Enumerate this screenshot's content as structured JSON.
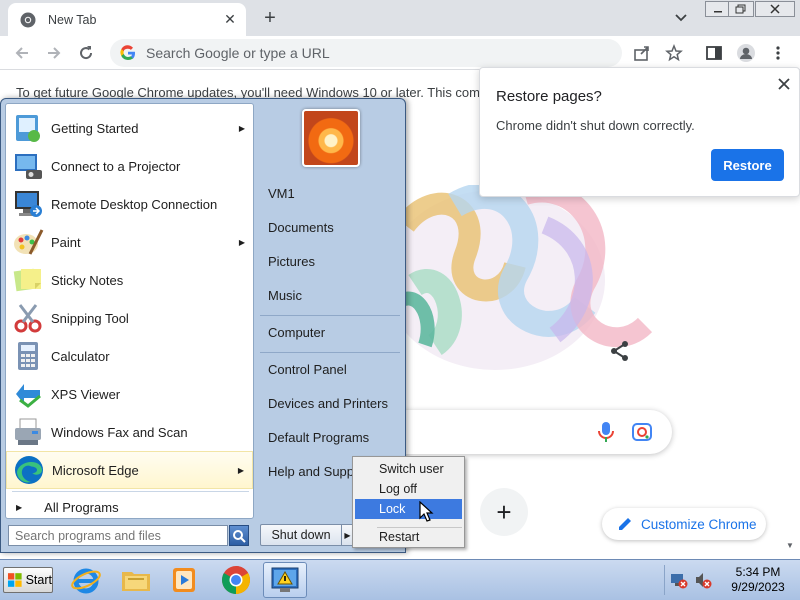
{
  "chrome": {
    "tab_title": "New Tab",
    "omnibox_placeholder": "Search Google or type a URL",
    "infobar_text": "To get future Google Chrome updates, you'll need Windows 10 or later. This com",
    "customize_label": "Customize Chrome",
    "colors": {
      "accent": "#1a73e8",
      "tabstrip": "#dee1e6"
    }
  },
  "restore_bubble": {
    "title": "Restore pages?",
    "message": "Chrome didn't shut down correctly.",
    "button_label": "Restore"
  },
  "start_menu": {
    "programs": [
      {
        "label": "Getting Started",
        "icon": "getting-started-icon",
        "submenu": true
      },
      {
        "label": "Connect to a Projector",
        "icon": "projector-icon",
        "submenu": false
      },
      {
        "label": "Remote Desktop Connection",
        "icon": "remote-desktop-icon",
        "submenu": false
      },
      {
        "label": "Paint",
        "icon": "paint-icon",
        "submenu": true
      },
      {
        "label": "Sticky Notes",
        "icon": "sticky-notes-icon",
        "submenu": false
      },
      {
        "label": "Snipping Tool",
        "icon": "snipping-tool-icon",
        "submenu": false
      },
      {
        "label": "Calculator",
        "icon": "calculator-icon",
        "submenu": false
      },
      {
        "label": "XPS Viewer",
        "icon": "xps-viewer-icon",
        "submenu": false
      },
      {
        "label": "Windows Fax and Scan",
        "icon": "fax-scan-icon",
        "submenu": false
      },
      {
        "label": "Microsoft Edge",
        "icon": "edge-icon",
        "submenu": true,
        "highlighted": true
      }
    ],
    "all_programs": "All Programs",
    "search_placeholder": "Search programs and files",
    "right_items": {
      "user": "VM1",
      "documents": "Documents",
      "pictures": "Pictures",
      "music": "Music",
      "computer": "Computer",
      "control_panel": "Control Panel",
      "devices": "Devices and Printers",
      "default_programs": "Default Programs",
      "help": "Help and Support"
    },
    "shutdown_label": "Shut down"
  },
  "shutdown_menu": {
    "items": [
      "Switch user",
      "Log off",
      "Lock",
      "Restart"
    ],
    "selected": "Lock"
  },
  "taskbar": {
    "start_label": "Start",
    "pinned": [
      "internet-explorer-icon",
      "file-explorer-icon",
      "media-player-icon",
      "chrome-icon",
      "action-center-icon"
    ],
    "time": "5:34 PM",
    "date": "9/29/2023"
  }
}
